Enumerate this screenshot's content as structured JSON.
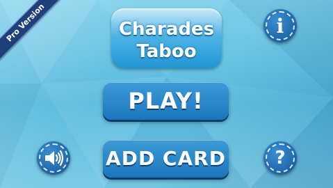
{
  "ribbon": {
    "label": "Pro Version"
  },
  "logo": {
    "line1": "Charades",
    "line2": "Taboo"
  },
  "buttons": {
    "play": "PLAY!",
    "add_card": "ADD CARD"
  },
  "icons": {
    "info": "i",
    "help": "?",
    "sound": "speaker-icon"
  },
  "colors": {
    "background": "#6cc3e3",
    "button": "#1f7fc4",
    "ribbon": "#1f3f7a"
  }
}
